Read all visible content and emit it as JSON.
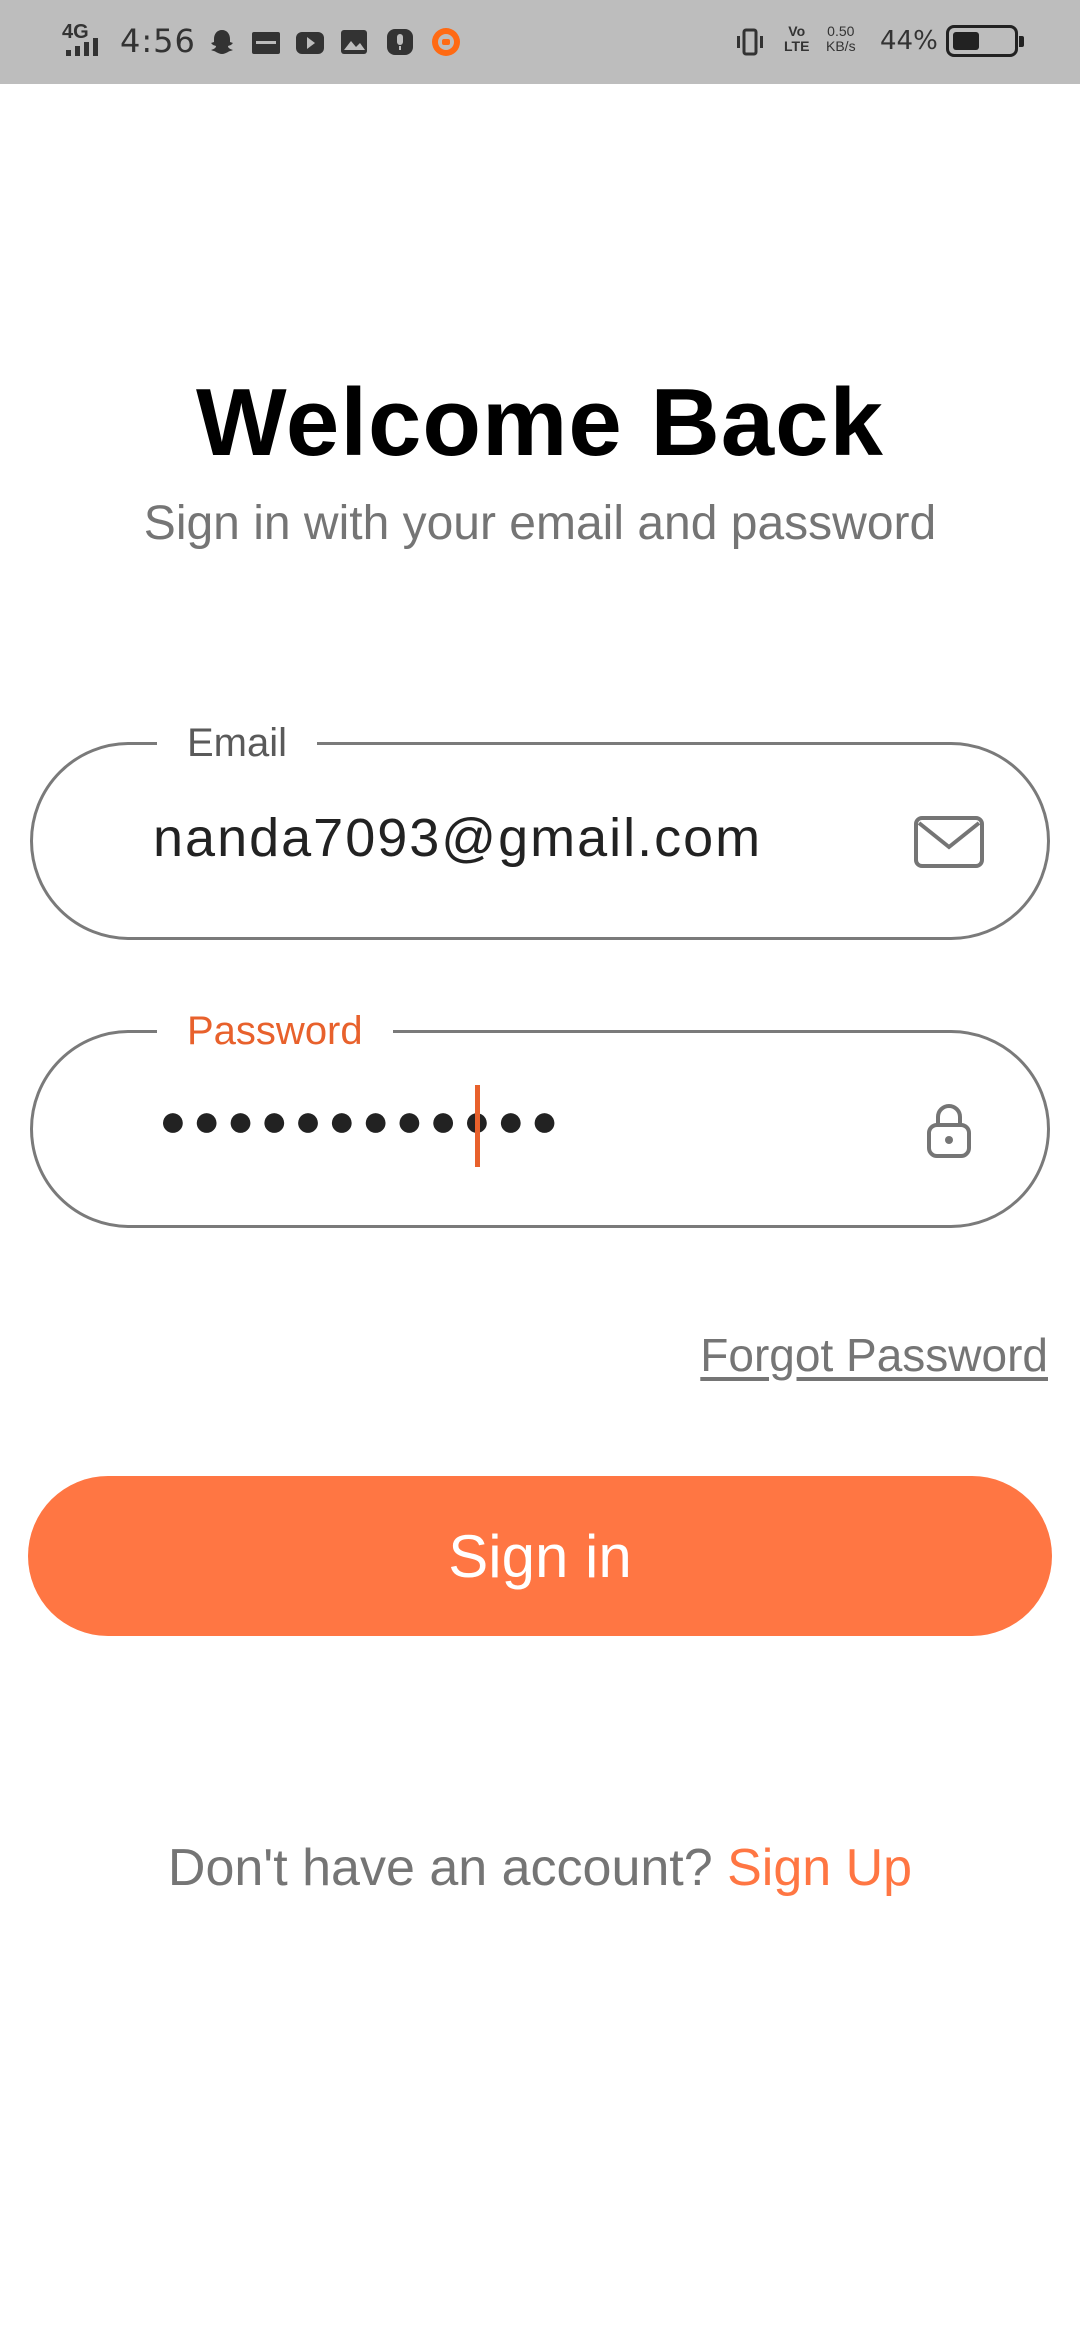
{
  "status_bar": {
    "network": "4G",
    "time": "4:56",
    "speed_value": "0.50",
    "speed_unit": "KB/s",
    "volte_top": "Vo",
    "volte_bottom": "LTE",
    "battery_percent": "44%",
    "battery_level": 0.44,
    "icons": [
      "snapchat-icon",
      "news-icon",
      "youtube-icon",
      "gallery-icon",
      "mic-icon",
      "mi-icon",
      "vibrate-icon",
      "volte-icon"
    ]
  },
  "header": {
    "title": "Welcome Back",
    "subtitle": "Sign in with your email and password"
  },
  "email": {
    "label": "Email",
    "value": "nanda7093@gmail.com",
    "icon": "mail-icon"
  },
  "password": {
    "label": "Password",
    "masked_value": "●●●●●●●●●●●●",
    "icon": "lock-icon"
  },
  "forgot_label": "Forgot Password",
  "signin_label": "Sign in",
  "signup": {
    "prompt": "Don't have an account?",
    "link": "Sign Up"
  },
  "colors": {
    "accent": "#ff7643",
    "label_active": "#e8612c",
    "status_bar": "#bdbdbd"
  }
}
